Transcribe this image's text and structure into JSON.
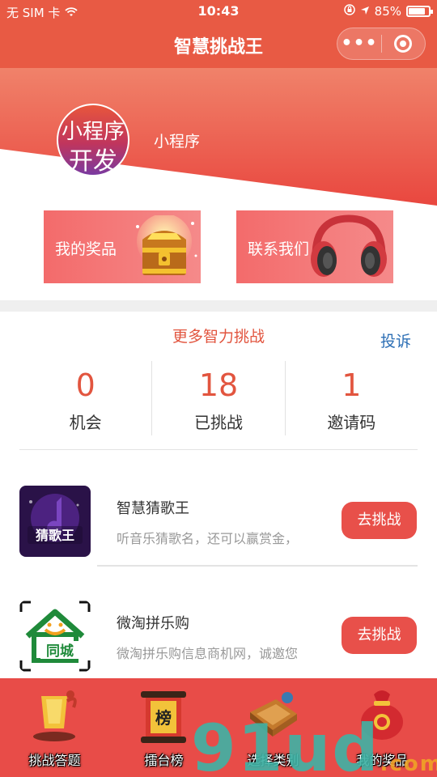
{
  "status_bar": {
    "carrier": "无 SIM 卡",
    "time": "10:43",
    "battery": "85%"
  },
  "nav": {
    "title": "智慧挑战王",
    "more_glyph": "•••"
  },
  "profile": {
    "avatar_line1": "小程序",
    "avatar_line2": "开发",
    "username": "小程序"
  },
  "cards": [
    {
      "label": "我的奖品"
    },
    {
      "label": "联系我们"
    }
  ],
  "challenge": {
    "title": "更多智力挑战",
    "report": "投诉"
  },
  "stats": [
    {
      "value": "0",
      "label": "机会"
    },
    {
      "value": "18",
      "label": "已挑战"
    },
    {
      "value": "1",
      "label": "邀请码"
    }
  ],
  "games": [
    {
      "name": "智慧猜歌王",
      "desc": "听音乐猜歌名，还可以赢赏金，",
      "button": "去挑战",
      "icon_text": "猜歌王"
    },
    {
      "name": "微淘拼乐购",
      "desc": "微淘拼乐购信息商机网，诚邀您",
      "button": "去挑战",
      "icon_text": "同城"
    }
  ],
  "tabs": [
    {
      "label": "挑战答题"
    },
    {
      "label": "擂台榜",
      "icon_text": "榜"
    },
    {
      "label": "选择类别"
    },
    {
      "label": "我的奖品"
    }
  ],
  "watermark": {
    "text": "91ud",
    "dot": ".com"
  },
  "colors": {
    "brand": "#e85a44",
    "accent_red": "#e2553f",
    "button": "#e8504a",
    "link_blue": "#2d6fb5"
  }
}
